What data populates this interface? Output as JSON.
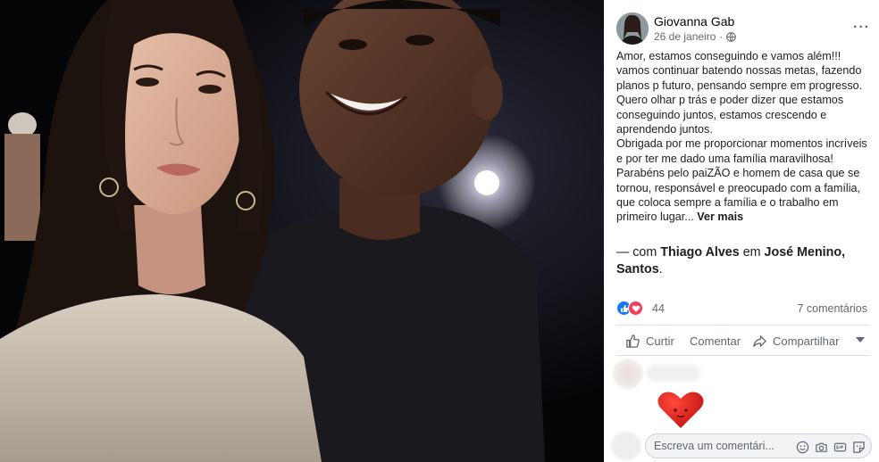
{
  "post": {
    "author": "Giovanna Gab",
    "date": "26 de janeiro",
    "privacy_icon": "globe-icon",
    "more_icon": "ellipsis-icon",
    "paragraphs": [
      "Amor, estamos conseguindo e vamos além!!!",
      "vamos continuar batendo nossas metas, fazendo planos p futuro, pensando sempre em progresso. Quero olhar p trás e poder dizer que estamos conseguindo juntos, estamos crescendo e aprendendo juntos.",
      "Obrigada por me proporcionar momentos incríveis e por ter me dado uma família maravilhosa!",
      "Parabéns pelo paiZÃO e homem de casa que se tornou, responsável e preocupado com a família, que coloca sempre a família e o trabalho em primeiro lugar..."
    ],
    "see_more": "Ver mais",
    "with_prefix": "— com ",
    "tagged_person": "Thiago Alves",
    "location_prefix": " em ",
    "location": "José Menino, Santos",
    "location_suffix": "."
  },
  "reactions": {
    "count": "44",
    "icons": [
      "like-icon",
      "love-icon"
    ],
    "comments": "7 comentários"
  },
  "actions": {
    "like": "Curtir",
    "comment": "Comentar",
    "share": "Compartilhar"
  },
  "composer": {
    "placeholder": "Escreva um comentári...",
    "icons": [
      "emoji-icon",
      "camera-icon",
      "gif-icon",
      "sticker-icon"
    ]
  },
  "colors": {
    "like_blue": "#1877f2",
    "love_red": "#f33e58",
    "text": "#1c1e21",
    "secondary": "#65676b"
  }
}
